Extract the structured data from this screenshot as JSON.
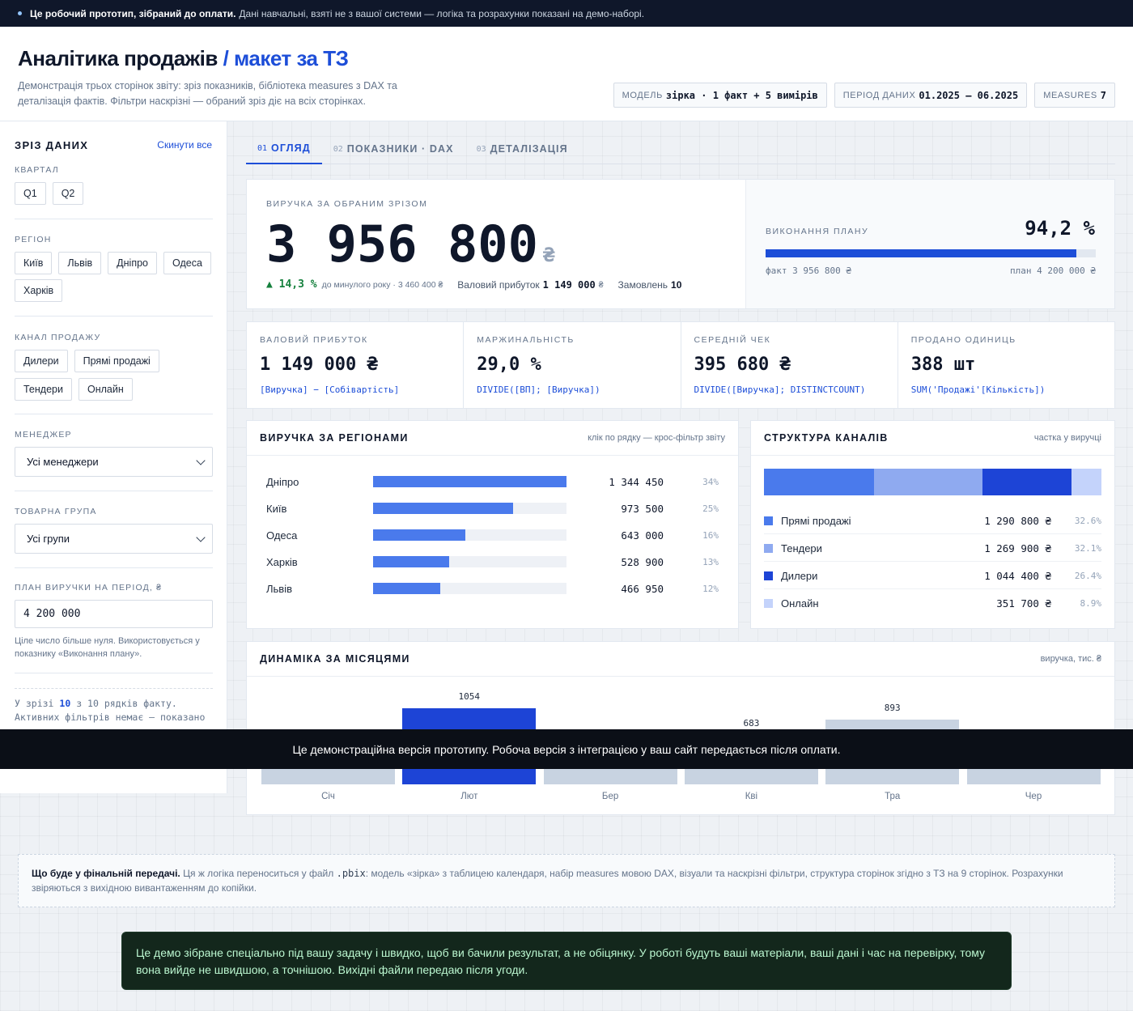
{
  "topbar": {
    "bold": "Це робочий прототип, зібраний до оплати.",
    "text": "Дані навчальні, взяті не з вашої системи — логіка та розрахунки показані на демо-наборі."
  },
  "header": {
    "title": "Аналітика продажів",
    "title_accent": "/ макет за ТЗ",
    "desc": "Демонстрація трьох сторінок звіту: зріз показників, бібліотека measures з DAX та деталізація фактів. Фільтри наскрізні — обраний зріз діє на всіх сторінках.",
    "chips": [
      {
        "label": "МОДЕЛЬ",
        "value": "зірка · 1 факт + 5 вимірів"
      },
      {
        "label": "ПЕРІОД ДАНИХ",
        "value": "01.2025 – 06.2025"
      },
      {
        "label": "MEASURES",
        "value": "7"
      }
    ]
  },
  "sidebar": {
    "title": "ЗРІЗ ДАНИХ",
    "reset": "Скинути все",
    "quarter": {
      "label": "КВАРТАЛ",
      "options": [
        "Q1",
        "Q2"
      ]
    },
    "region": {
      "label": "РЕГІОН",
      "options": [
        "Київ",
        "Львів",
        "Дніпро",
        "Одеса",
        "Харків"
      ]
    },
    "channel": {
      "label": "КАНАЛ ПРОДАЖУ",
      "options": [
        "Дилери",
        "Прямі продажі",
        "Тендери",
        "Онлайн"
      ]
    },
    "manager": {
      "label": "МЕНЕДЖЕР",
      "value": "Усі менеджери"
    },
    "group": {
      "label": "ТОВАРНА ГРУПА",
      "value": "Усі групи"
    },
    "plan": {
      "label": "ПЛАН ВИРУЧКИ НА ПЕРІОД, ₴",
      "value": "4 200 000",
      "hint": "Ціле число більше нуля. Використовується у показнику «Виконання плану»."
    },
    "summary_prefix": "У зрізі",
    "summary_count": "10",
    "summary_rest": "з 10 рядків факту. Активних фільтрів немає — показано"
  },
  "tabs": [
    {
      "num": "01",
      "label": "ОГЛЯД"
    },
    {
      "num": "02",
      "label": "ПОКАЗНИКИ · DAX"
    },
    {
      "num": "03",
      "label": "ДЕТАЛІЗАЦІЯ"
    }
  ],
  "hero": {
    "kicker": "ВИРУЧКА ЗА ОБРАНИМ ЗРІЗОМ",
    "value": "3 956 800",
    "currency": "₴",
    "growth": "▲ 14,3 %",
    "growth_note": "до минулого року · 3 460 400 ₴",
    "gp_label": "Валовий прибуток",
    "gp_value": "1 149 000",
    "gp_cur": "₴",
    "orders_label": "Замовлень",
    "orders_value": "10",
    "plan_kicker": "ВИКОНАННЯ ПЛАНУ",
    "plan_pct": "94,2 %",
    "plan_fraction": 0.942,
    "plan_fact": "факт 3 956 800 ₴",
    "plan_plan": "план 4 200 000 ₴"
  },
  "kpis": [
    {
      "label": "ВАЛОВИЙ ПРИБУТОК",
      "value": "1 149 000 ₴",
      "dax": "[Виручка] − [Собівартість]"
    },
    {
      "label": "МАРЖИНАЛЬНІСТЬ",
      "value": "29,0 %",
      "dax": "DIVIDE([ВП]; [Виручка])"
    },
    {
      "label": "СЕРЕДНІЙ ЧЕК",
      "value": "395 680 ₴",
      "dax": "DIVIDE([Виручка]; DISTINCTCOUNT)"
    },
    {
      "label": "ПРОДАНО ОДИНИЦЬ",
      "value": "388 шт",
      "dax": "SUM('Продажі'[Кількість])"
    }
  ],
  "regions": {
    "title": "ВИРУЧКА ЗА РЕГІОНАМИ",
    "note": "клік по рядку — крос-фільтр звіту",
    "rows": [
      {
        "name": "Дніпро",
        "value": "1 344 450",
        "pct": "34%",
        "share": 1.0
      },
      {
        "name": "Київ",
        "value": "973 500",
        "pct": "25%",
        "share": 0.724
      },
      {
        "name": "Одеса",
        "value": "643 000",
        "pct": "16%",
        "share": 0.478
      },
      {
        "name": "Харків",
        "value": "528 900",
        "pct": "13%",
        "share": 0.393
      },
      {
        "name": "Львів",
        "value": "466 950",
        "pct": "12%",
        "share": 0.347
      }
    ]
  },
  "channels": {
    "title": "СТРУКТУРА КАНАЛІВ",
    "note": "частка у виручці",
    "rows": [
      {
        "name": "Прямі продажі",
        "value": "1 290 800 ₴",
        "pct": "32.6%",
        "share": 0.326,
        "color": "#4a7aec"
      },
      {
        "name": "Тендери",
        "value": "1 269 900 ₴",
        "pct": "32.1%",
        "share": 0.321,
        "color": "#8faaf0"
      },
      {
        "name": "Дилери",
        "value": "1 044 400 ₴",
        "pct": "26.4%",
        "share": 0.264,
        "color": "#1d44d6"
      },
      {
        "name": "Онлайн",
        "value": "351 700 ₴",
        "pct": "8.9%",
        "share": 0.089,
        "color": "#c4d3fb"
      }
    ]
  },
  "monthly": {
    "title": "ДИНАМІКА ЗА МІСЯЦЯМИ",
    "note": "виручка, тис. ₴",
    "chart_data": {
      "type": "bar",
      "categories": [
        "Січ",
        "Лют",
        "Бер",
        "Кві",
        "Тра",
        "Чер"
      ],
      "values": [
        486,
        1054,
        466,
        683,
        893,
        373
      ],
      "labels": [
        "486",
        "1054",
        "466",
        "683",
        "893",
        ""
      ],
      "highlight_index": 1,
      "ylim": [
        0,
        1054
      ]
    }
  },
  "demo_strip": "Це демонстраційна версія прототипу. Робоча версія з інтеграцією у ваш сайт передається після оплати.",
  "final_note": {
    "bold": "Що буде у фінальній передачі.",
    "pre": "Ця ж логіка переноситься у файл",
    "file": ".pbix",
    "post": ": модель «зірка» з таблицею календаря, набір measures мовою DAX, візуали та наскрізні фільтри, структура сторінок згідно з ТЗ на 9 сторінок. Розрахунки звіряються з вихідною вивантаженням до копійки."
  },
  "toast": "Це демо зібране спеціально під вашу задачу і швидко, щоб ви бачили результат, а не обіцянку. У роботі будуть ваші матеріали, ваші дані і час на перевірку, тому вона вийде не швидшою, а точнішою. Вихідні файли передаю після угоди."
}
